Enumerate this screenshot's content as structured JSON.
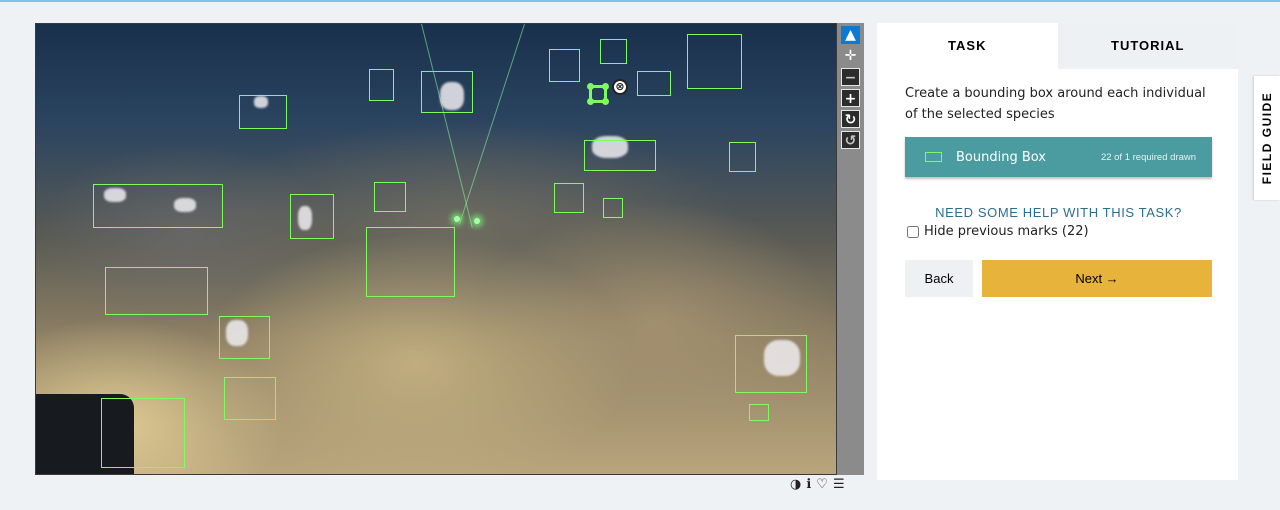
{
  "viewer": {
    "marks": [
      {
        "selected": false
      },
      {
        "selected": false
      },
      {
        "selected": false
      },
      {
        "selected": false
      },
      {
        "selected": false
      },
      {
        "selected": false
      },
      {
        "selected": false
      },
      {
        "selected": false
      },
      {
        "selected": false
      },
      {
        "selected": false
      },
      {
        "selected": false
      },
      {
        "selected": false
      },
      {
        "selected": false
      },
      {
        "selected": false
      },
      {
        "selected": false
      },
      {
        "selected": false
      },
      {
        "selected": false
      },
      {
        "selected": false
      },
      {
        "selected": false
      },
      {
        "selected": false
      },
      {
        "selected": false
      },
      {
        "selected": true
      }
    ],
    "delete_icon": "⊗"
  },
  "toolbar": {
    "pointer_icon": "▲",
    "move_icon": "✛",
    "zoom_out_icon": "−",
    "zoom_in_icon": "+",
    "rotate_icon": "↻",
    "reset_icon": "↺"
  },
  "footer": {
    "invert_icon": "◑",
    "info_icon": "ℹ",
    "favorite_icon": "♡",
    "collections_icon": "☰"
  },
  "panel": {
    "tabs": [
      {
        "label": "TASK",
        "active": true
      },
      {
        "label": "TUTORIAL",
        "active": false
      }
    ],
    "instruction": "Create a bounding box around each individual of the selected species",
    "tool": {
      "label": "Bounding Box",
      "count": "22 of 1 required drawn",
      "color": "#7dfc5c"
    },
    "help_link": "NEED SOME HELP WITH THIS TASK?",
    "hide_marks_label": "Hide previous marks (22)",
    "hide_marks_checked": false,
    "back_label": "Back",
    "next_label": "Next →"
  },
  "field_guide": {
    "label": "FIELD GUIDE"
  },
  "colors": {
    "accent_teal": "#4a9ca0",
    "next_yellow": "#e8b33a",
    "mark_green": "#7dfc5c",
    "toolbar_gray": "#8b8b8b",
    "active_tool_blue": "#0b7ad1"
  }
}
